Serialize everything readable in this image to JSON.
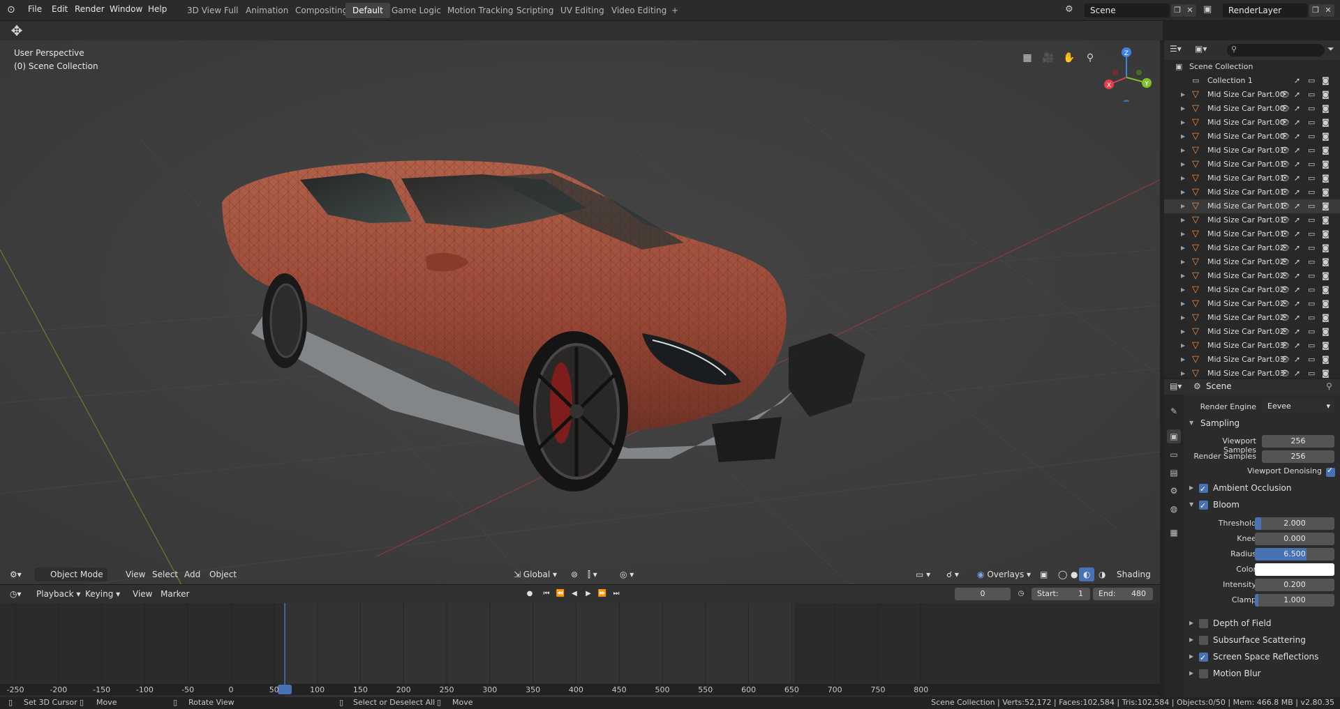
{
  "topbar": {
    "menus": [
      "File",
      "Edit",
      "Render",
      "Window",
      "Help"
    ],
    "workspaces": [
      "3D View Full",
      "Animation",
      "Compositing",
      "Default",
      "Game Logic",
      "Motion Tracking",
      "Scripting",
      "UV Editing",
      "Video Editing"
    ],
    "active_workspace": "Default",
    "add_tab": "+",
    "scene_name": "Scene",
    "render_layer": "RenderLayer"
  },
  "viewport": {
    "perspective_label": "User Perspective",
    "collection_label": "(0) Scene Collection",
    "gizmo_axes": [
      "Z",
      "Y",
      "X"
    ],
    "header": {
      "mode": "Object Mode",
      "menus": [
        "View",
        "Select",
        "Add",
        "Object"
      ],
      "orientation": "Global",
      "overlays": "Overlays",
      "shading": "Shading"
    }
  },
  "timeline": {
    "menus": [
      "Playback",
      "Keying",
      "View",
      "Marker"
    ],
    "current_frame": "0",
    "start_label": "Start:",
    "start": "1",
    "end_label": "End:",
    "end": "480",
    "ticks": [
      "-250",
      "-200",
      "-150",
      "-100",
      "-50",
      "0",
      "50",
      "100",
      "150",
      "200",
      "250",
      "300",
      "350",
      "400",
      "450",
      "500",
      "550",
      "600",
      "650",
      "700",
      "750",
      "800"
    ]
  },
  "statusbar": {
    "items": [
      "Set 3D Cursor",
      "Move",
      "Rotate View",
      "Select or Deselect All",
      "Move"
    ],
    "stats": "Scene Collection | Verts:52,172 | Faces:102,584 | Tris:102,584 | Objects:0/50 | Mem: 466.8 MB | v2.80.35"
  },
  "outliner": {
    "root": "Scene Collection",
    "collection": "Collection 1",
    "items": [
      "Mid Size Car Part.00",
      "Mid Size Car Part.00",
      "Mid Size Car Part.00",
      "Mid Size Car Part.00",
      "Mid Size Car Part.01",
      "Mid Size Car Part.01",
      "Mid Size Car Part.01",
      "Mid Size Car Part.01",
      "Mid Size Car Part.01",
      "Mid Size Car Part.01",
      "Mid Size Car Part.01",
      "Mid Size Car Part.02",
      "Mid Size Car Part.02",
      "Mid Size Car Part.02",
      "Mid Size Car Part.02",
      "Mid Size Car Part.02",
      "Mid Size Car Part.02",
      "Mid Size Car Part.02",
      "Mid Size Car Part.03",
      "Mid Size Car Part.03",
      "Mid Size Car Part.03"
    ],
    "selected_index": 8
  },
  "properties": {
    "context": "Scene",
    "render_engine_label": "Render Engine",
    "render_engine": "Eevee",
    "sampling": {
      "title": "Sampling",
      "viewport_samples_label": "Viewport Samples",
      "viewport_samples": "256",
      "render_samples_label": "Render Samples",
      "render_samples": "256",
      "viewport_denoising_label": "Viewport Denoising",
      "viewport_denoising": true
    },
    "ambient_occlusion": {
      "title": "Ambient Occlusion",
      "enabled": true
    },
    "bloom": {
      "title": "Bloom",
      "enabled": true,
      "threshold_label": "Threshold",
      "threshold": "2.000",
      "threshold_fill": 0.08,
      "knee_label": "Knee",
      "knee": "0.000",
      "radius_label": "Radius",
      "radius": "6.500",
      "radius_fill": 0.65,
      "color_label": "Color",
      "color": "#ffffff",
      "intensity_label": "Intensity",
      "intensity": "0.200",
      "clamp_label": "Clamp",
      "clamp": "1.000",
      "clamp_fill": 0.04
    },
    "depth_of_field": {
      "title": "Depth of Field",
      "enabled": false
    },
    "subsurface": {
      "title": "Subsurface Scattering",
      "enabled": false
    },
    "ssr": {
      "title": "Screen Space Reflections",
      "enabled": true
    },
    "motion_blur": {
      "title": "Motion Blur",
      "enabled": false
    }
  },
  "colors": {
    "accent": "#4772b3",
    "car_body": "#a0503a",
    "object_icon": "#f08b3a",
    "playhead": "#4772b3"
  }
}
